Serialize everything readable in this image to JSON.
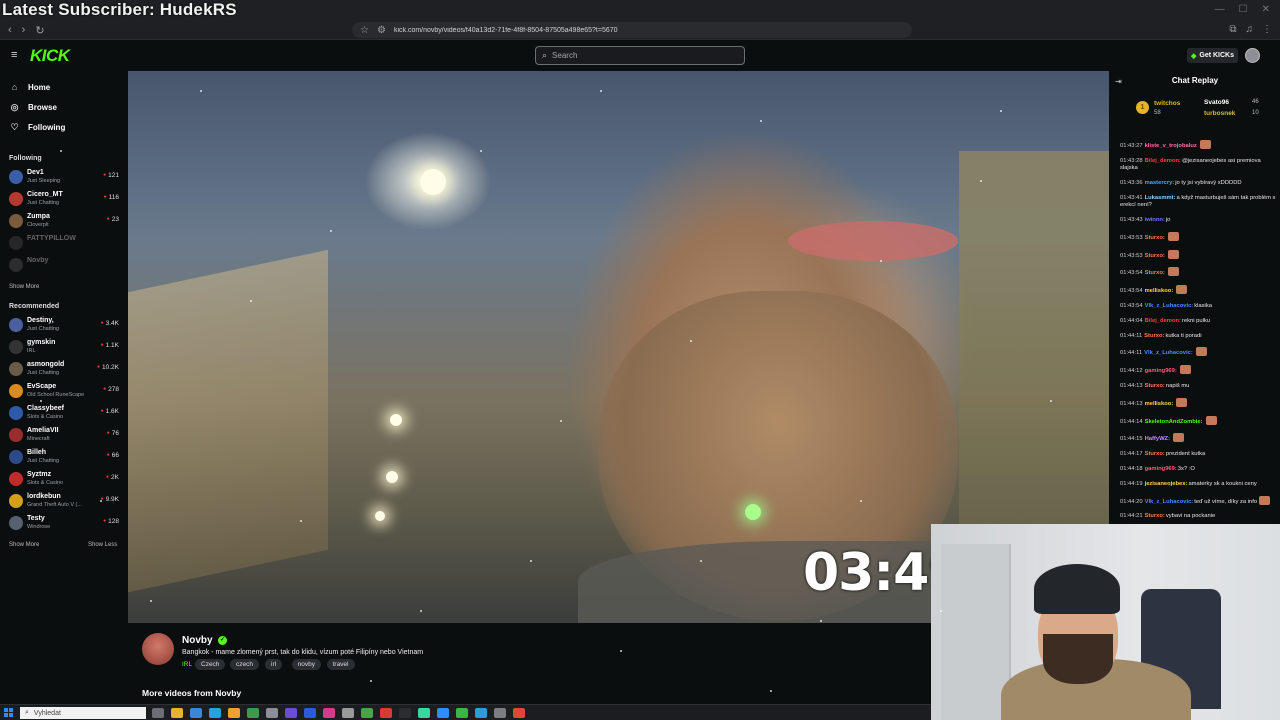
{
  "overlay": {
    "latest_subscriber": "Latest Subscriber: HudekRS"
  },
  "browser": {
    "url": "kick.com/novby/videos/f40a13d2-71fe-4f8f-8504-87505a498e65?t=5670"
  },
  "header": {
    "logo": "KICK",
    "search_placeholder": "Search",
    "get_kicks_label": "Get KICKs"
  },
  "sidebar": {
    "nav": [
      {
        "label": "Home",
        "icon": "home-icon"
      },
      {
        "label": "Browse",
        "icon": "compass-icon"
      },
      {
        "label": "Following",
        "icon": "heart-icon"
      }
    ],
    "following_title": "Following",
    "following": [
      {
        "name": "Dev1",
        "category": "Just Sleeping",
        "viewers": "121",
        "color": "#3a5fa8",
        "online": true
      },
      {
        "name": "Cicero_MT",
        "category": "Just Chatting",
        "viewers": "116",
        "color": "#b6392f",
        "online": true
      },
      {
        "name": "Zumpa",
        "category": "Cloverpit",
        "viewers": "23",
        "color": "#7a5b3b",
        "online": true
      },
      {
        "name": "FATTYPILLOW",
        "category": "",
        "viewers": "",
        "color": "#555",
        "online": false
      },
      {
        "name": "Novby",
        "category": "",
        "viewers": "",
        "color": "#666",
        "online": false
      }
    ],
    "show_more": "Show More",
    "recommended_title": "Recommended",
    "recommended": [
      {
        "name": "Destiny,",
        "category": "Just Chatting",
        "viewers": "3.4K",
        "color": "#4d5fa0"
      },
      {
        "name": "gymskin",
        "category": "IRL",
        "viewers": "1.1K",
        "color": "#333"
      },
      {
        "name": "asmongold",
        "category": "Just Chatting",
        "viewers": "10.2K",
        "color": "#6a5a4a"
      },
      {
        "name": "EvScape",
        "category": "Old School RuneScape",
        "viewers": "278",
        "color": "#d88b1f"
      },
      {
        "name": "Classybeef",
        "category": "Slots & Casino",
        "viewers": "1.6K",
        "color": "#2b5aa8"
      },
      {
        "name": "AmeliaVII",
        "category": "Minecraft",
        "viewers": "76",
        "color": "#9a2d2d"
      },
      {
        "name": "Billeh",
        "category": "Just Chatting",
        "viewers": "66",
        "color": "#2d4a8a"
      },
      {
        "name": "Syztmz",
        "category": "Slots & Casino",
        "viewers": "2K",
        "color": "#c02a2a"
      },
      {
        "name": "lordkebun",
        "category": "Grand Theft Auto V (...",
        "viewers": "9.9K",
        "color": "#d4a019"
      },
      {
        "name": "Testy",
        "category": "Windrose",
        "viewers": "128",
        "color": "#556070"
      }
    ],
    "show_more_2": "Show More",
    "show_less": "Show Less"
  },
  "video": {
    "timer_text": "03:49"
  },
  "stream_info": {
    "name": "Novby",
    "title": "Bangkok - mame zlomený prst, tak do klidu,  vízum poté Filipíny nebo Vietnam",
    "category": "IRL",
    "tags": [
      "Czech",
      "czech",
      "irl",
      "novby",
      "travel"
    ],
    "more_videos": "More videos from Novby"
  },
  "chat": {
    "title": "Chat Replay",
    "pinned": [
      {
        "user": "twitchos",
        "amount": "58",
        "color": "#e5b427"
      },
      {
        "user": "Svato96",
        "amount": "46",
        "color": "#ffffff"
      },
      {
        "user": "turbosnek",
        "amount": "10",
        "color": "#e5b427"
      }
    ],
    "messages": [
      {
        "ts": "01:43:27",
        "user": "kliste_v_trojobaluz",
        "uc": "#ff6ea8",
        "text": "",
        "emote": true
      },
      {
        "ts": "01:43:28",
        "user": "Bilej_demon:",
        "uc": "#ff4040",
        "text": "@jezisaneojebes asi premiova slajska",
        "emote": false
      },
      {
        "ts": "01:43:36",
        "user": "mastercry:",
        "uc": "#4aa3ff",
        "text": "jo ty jsi vybíravý xDDDDD",
        "emote": false
      },
      {
        "ts": "01:43:41",
        "user": "Lukasmmt:",
        "uc": "#8bd0ff",
        "text": "a když masturbuješ sám tak problém s erekcí není?",
        "emote": false
      },
      {
        "ts": "01:43:43",
        "user": "iwinnn:",
        "uc": "#6e7bff",
        "text": "jo",
        "emote": false
      },
      {
        "ts": "01:43:53",
        "user": "Sturxo:",
        "uc": "#ff7a4a",
        "text": "",
        "emote": true
      },
      {
        "ts": "01:43:53",
        "user": "Sturxo:",
        "uc": "#ff7a4a",
        "text": "",
        "emote": true
      },
      {
        "ts": "01:43:54",
        "user": "Sturxo:",
        "uc": "#ff7a4a",
        "text": "",
        "emote": true
      },
      {
        "ts": "01:43:54",
        "user": "melliskoo:",
        "uc": "#ffd84a",
        "text": "",
        "emote": true
      },
      {
        "ts": "01:43:54",
        "user": "Vlk_z_Luhacovic:",
        "uc": "#4a8bff",
        "text": "klasika",
        "emote": false
      },
      {
        "ts": "01:44:04",
        "user": "Bilej_demon:",
        "uc": "#ff4040",
        "text": "rekni pulku",
        "emote": false
      },
      {
        "ts": "01:44:11",
        "user": "Sturxo:",
        "uc": "#ff7a4a",
        "text": "kutka ti poradi",
        "emote": false
      },
      {
        "ts": "01:44:11",
        "user": "Vlk_z_Luhacovic:",
        "uc": "#4a8bff",
        "text": "",
        "emote": true
      },
      {
        "ts": "01:44:12",
        "user": "gaming969:",
        "uc": "#ff5a7a",
        "text": "",
        "emote": true
      },
      {
        "ts": "01:44:13",
        "user": "Sturxo:",
        "uc": "#ff7a4a",
        "text": "napiš mu",
        "emote": false
      },
      {
        "ts": "01:44:13",
        "user": "melliskoo:",
        "uc": "#ffd84a",
        "text": "",
        "emote": true
      },
      {
        "ts": "01:44:14",
        "user": "SkeletonAndZombie:",
        "uc": "#53fc18",
        "text": "",
        "emote": true
      },
      {
        "ts": "01:44:15",
        "user": "HaffyWZ:",
        "uc": "#c58bff",
        "text": "",
        "emote": true
      },
      {
        "ts": "01:44:17",
        "user": "Sturxo:",
        "uc": "#ff7a4a",
        "text": "prezident kutka",
        "emote": false
      },
      {
        "ts": "01:44:18",
        "user": "gaming969:",
        "uc": "#ff5a7a",
        "text": "3x? :O",
        "emote": false
      },
      {
        "ts": "01:44:19",
        "user": "jezisaneojebes:",
        "uc": "#ffd84a",
        "text": "amaterky sk a koukni ceny",
        "emote": false
      },
      {
        "ts": "01:44:20",
        "user": "Vlk_z_Luhacovic:",
        "uc": "#4a8bff",
        "text": "teď už víme, díky za info",
        "emote": true
      },
      {
        "ts": "01:44:21",
        "user": "Sturxo:",
        "uc": "#ff7a4a",
        "text": "vybavi na pockanie",
        "emote": false
      }
    ]
  },
  "taskbar": {
    "search_placeholder": "Vyhledat"
  }
}
